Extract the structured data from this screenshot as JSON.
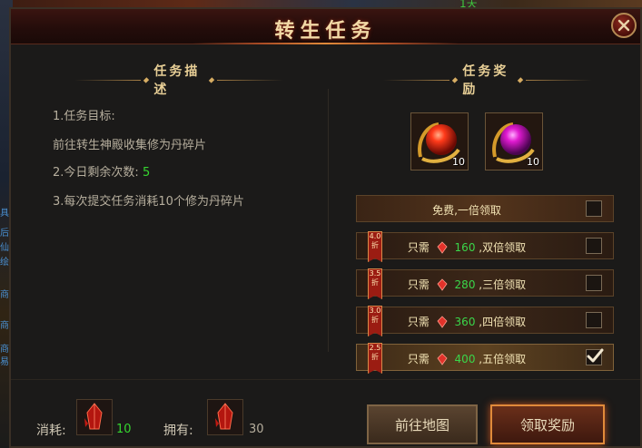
{
  "background": {
    "top_text": "1天",
    "side_chars": [
      "具",
      "后",
      "仙",
      "绘",
      "商",
      "商",
      "商",
      "易"
    ]
  },
  "window": {
    "title": "转生任务",
    "close_icon": "close-x-icon"
  },
  "task_description": {
    "header": "任务描述",
    "lines": {
      "objective_label": "1.任务目标:",
      "objective_text": "前往转生神殿收集修为丹碎片",
      "remaining_label": "2.今日剩余次数:",
      "remaining_value": "5",
      "cost_text": "3.每次提交任务消耗10个修为丹碎片"
    }
  },
  "task_reward": {
    "header": "任务奖励",
    "items": [
      {
        "icon": "red-orb-icon",
        "count": "10"
      },
      {
        "icon": "purple-orb-icon",
        "count": "10"
      }
    ],
    "options": [
      {
        "free_text": "免费,一倍领取",
        "checked": false
      },
      {
        "discount": "4.0",
        "discount_unit": "折",
        "need": "只需",
        "amount": "160",
        "mult": ",双倍领取",
        "checked": false
      },
      {
        "discount": "3.5",
        "discount_unit": "折",
        "need": "只需",
        "amount": "280",
        "mult": ",三倍领取",
        "checked": false
      },
      {
        "discount": "3.0",
        "discount_unit": "折",
        "need": "只需",
        "amount": "360",
        "mult": ",四倍领取",
        "checked": false
      },
      {
        "discount": "2.5",
        "discount_unit": "折",
        "need": "只需",
        "amount": "400",
        "mult": ",五倍领取",
        "checked": true
      }
    ]
  },
  "footer": {
    "consume_label": "消耗:",
    "consume_value": "10",
    "own_label": "拥有:",
    "own_value": "30",
    "crystal_icon": "red-crystal-icon"
  },
  "buttons": {
    "go_map": "前往地图",
    "claim": "领取奖励"
  },
  "colors": {
    "accent_green": "#35d52f",
    "title_gold": "#f1d9a6",
    "discount_red": "#9b1c12"
  }
}
